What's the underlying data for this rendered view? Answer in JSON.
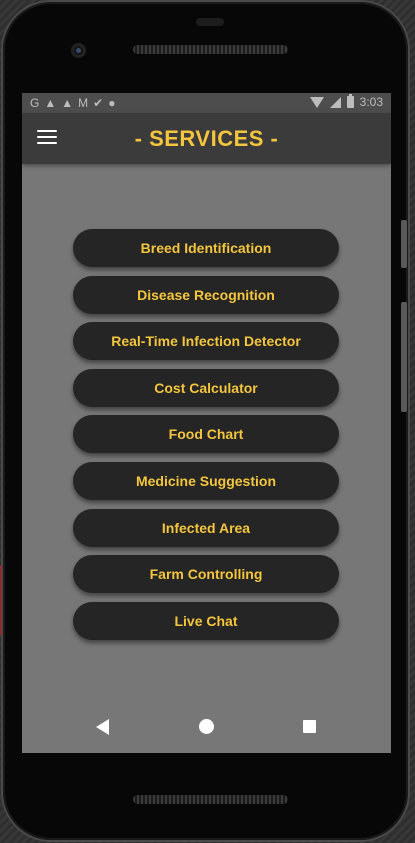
{
  "status_bar": {
    "left_icons": [
      "G",
      "▲",
      "▲",
      "M",
      "✔",
      "●"
    ],
    "time": "3:03"
  },
  "app_bar": {
    "title": "-  SERVICES  -",
    "menu_icon": "hamburger-icon"
  },
  "services": [
    {
      "label": "Breed Identification"
    },
    {
      "label": "Disease Recognition"
    },
    {
      "label": "Real-Time Infection Detector"
    },
    {
      "label": "Cost Calculator"
    },
    {
      "label": "Food Chart"
    },
    {
      "label": "Medicine Suggestion"
    },
    {
      "label": "Infected Area"
    },
    {
      "label": "Farm Controlling"
    },
    {
      "label": "Live Chat"
    }
  ],
  "colors": {
    "accent": "#f4c63d",
    "button_bg": "#252525",
    "screen_bg": "#777777",
    "app_bar_bg": "#3b3b3b"
  },
  "nav_bar": {
    "icons": [
      "back-icon",
      "home-icon",
      "recents-icon"
    ]
  }
}
